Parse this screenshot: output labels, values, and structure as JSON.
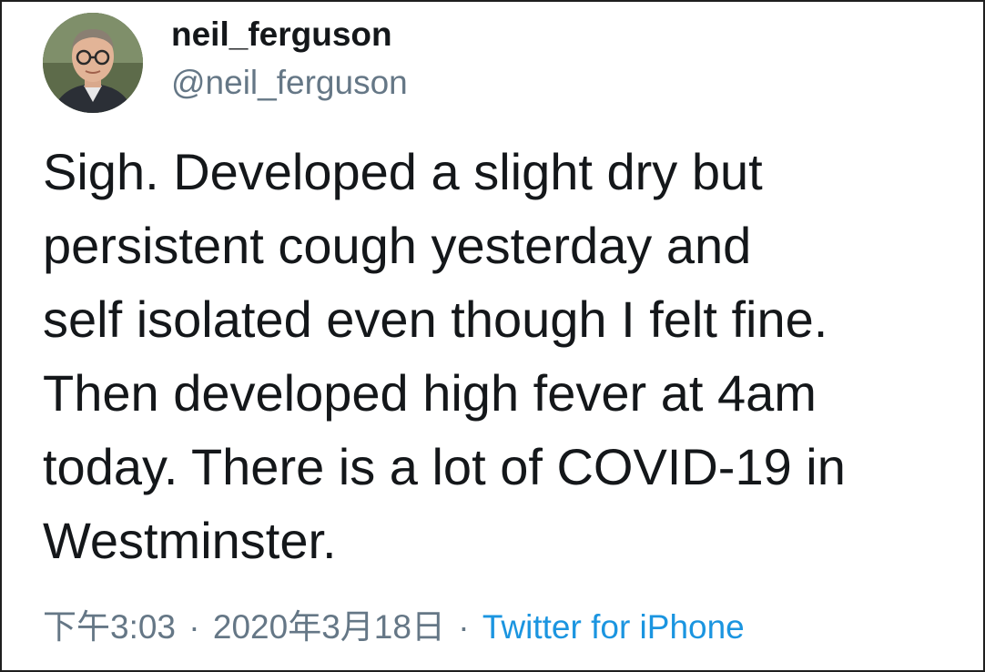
{
  "tweet": {
    "author": {
      "display_name": "neil_ferguson",
      "handle": "@neil_ferguson"
    },
    "text": "Sigh. Developed a slight dry but\npersistent cough yesterday and\nself isolated even though I felt fine.\nThen developed high fever at 4am\ntoday. There is a lot of COVID-19 in\nWestminster.",
    "time": "下午3:03",
    "separator": "·",
    "date": "2020年3月18日",
    "source": "Twitter for iPhone"
  },
  "colors": {
    "text": "#14171a",
    "secondary": "#657786",
    "link": "#1b95e0"
  }
}
